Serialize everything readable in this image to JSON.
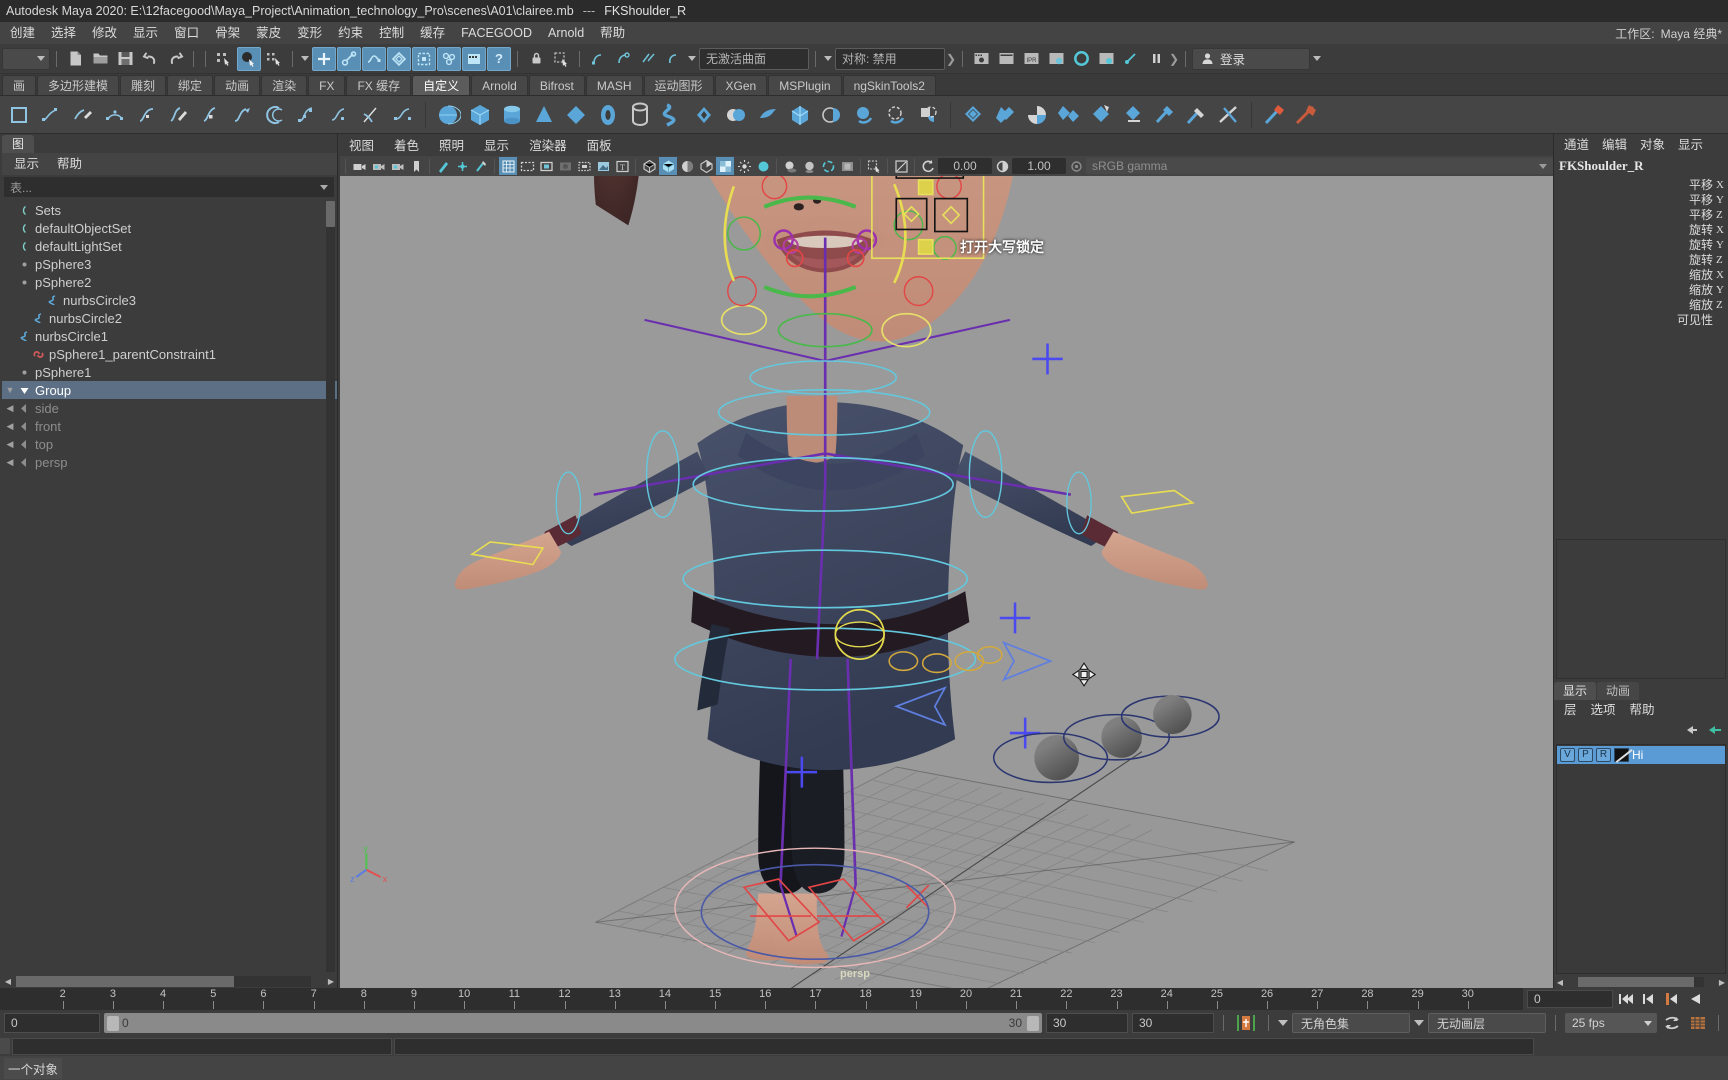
{
  "titlebar": {
    "app_title": "Autodesk Maya 2020: E:\\12facegood\\Maya_Project\\Animation_technology_Pro\\scenes\\A01\\clairee.mb",
    "separator": "---",
    "selected_node": "FKShoulder_R"
  },
  "menubar": {
    "items": [
      "创建",
      "选择",
      "修改",
      "显示",
      "窗口",
      "骨架",
      "蒙皮",
      "变形",
      "约束",
      "控制",
      "缓存",
      "FACEGOOD",
      "Arnold",
      "帮助"
    ],
    "workspace_label": "工作区:",
    "workspace_value": "Maya 经典*"
  },
  "statusline": {
    "mode_value": "",
    "live_surface_field": "无激活曲面",
    "symmetry_field": "对称: 禁用",
    "signin_label": "登录"
  },
  "shelf": {
    "tabs": [
      "画",
      "多边形建模",
      "雕刻",
      "绑定",
      "动画",
      "渲染",
      "FX",
      "FX 缓存",
      "自定义",
      "Arnold",
      "Bifrost",
      "MASH",
      "运动图形",
      "XGen",
      "MSPlugin",
      "ngSkinTools2"
    ],
    "active_tab": "自定义"
  },
  "outliner": {
    "tab_label": "图",
    "menu": [
      "显示",
      "帮助"
    ],
    "search_placeholder": "表...",
    "items": [
      {
        "label": "persp",
        "type": "camera",
        "depth": 0,
        "selected": false,
        "expand": "collapsed"
      },
      {
        "label": "top",
        "type": "camera",
        "depth": 0,
        "selected": false,
        "expand": "collapsed"
      },
      {
        "label": "front",
        "type": "camera",
        "depth": 0,
        "selected": false,
        "expand": "collapsed"
      },
      {
        "label": "side",
        "type": "camera",
        "depth": 0,
        "selected": false,
        "expand": "collapsed"
      },
      {
        "label": "Group",
        "type": "group",
        "depth": 0,
        "selected": true,
        "expand": "expanded"
      },
      {
        "label": "pSphere1",
        "type": "mesh",
        "depth": 0,
        "selected": false,
        "expand": "leaf"
      },
      {
        "label": "pSphere1_parentConstraint1",
        "type": "constraint",
        "depth": 1,
        "selected": false,
        "expand": "leaf"
      },
      {
        "label": "nurbsCircle1",
        "type": "curve",
        "depth": 0,
        "selected": false,
        "expand": "leaf"
      },
      {
        "label": "nurbsCircle2",
        "type": "curve",
        "depth": 1,
        "selected": false,
        "expand": "leaf"
      },
      {
        "label": "nurbsCircle3",
        "type": "curve",
        "depth": 2,
        "selected": false,
        "expand": "leaf"
      },
      {
        "label": "pSphere2",
        "type": "mesh",
        "depth": 0,
        "selected": false,
        "expand": "leaf"
      },
      {
        "label": "pSphere3",
        "type": "mesh",
        "depth": 0,
        "selected": false,
        "expand": "leaf"
      },
      {
        "label": "defaultLightSet",
        "type": "set",
        "depth": 0,
        "selected": false,
        "expand": "leaf"
      },
      {
        "label": "defaultObjectSet",
        "type": "set",
        "depth": 0,
        "selected": false,
        "expand": "leaf"
      },
      {
        "label": "Sets",
        "type": "set",
        "depth": 0,
        "selected": false,
        "expand": "leaf"
      }
    ]
  },
  "viewport": {
    "menu": [
      "视图",
      "着色",
      "照明",
      "显示",
      "渲染器",
      "面板"
    ],
    "exposure_value": "0.00",
    "gamma_value": "1.00",
    "color_profile": "sRGB gamma",
    "overlay_text": "打开大写锁定",
    "camera_label": "persp"
  },
  "channelbox": {
    "menu": [
      "通道",
      "编辑",
      "对象",
      "显示"
    ],
    "node_name": "FKShoulder_R",
    "attributes": [
      {
        "name": "平移",
        "axis": "X"
      },
      {
        "name": "平移",
        "axis": "Y"
      },
      {
        "name": "平移",
        "axis": "Z"
      },
      {
        "name": "旋转",
        "axis": "X"
      },
      {
        "name": "旋转",
        "axis": "Y"
      },
      {
        "name": "旋转",
        "axis": "Z"
      },
      {
        "name": "缩放",
        "axis": "X"
      },
      {
        "name": "缩放",
        "axis": "Y"
      },
      {
        "name": "缩放",
        "axis": "Z"
      },
      {
        "name": "可见性",
        "axis": ""
      }
    ]
  },
  "layereditor": {
    "tabs": [
      "显示",
      "动画"
    ],
    "active_tab": "显示",
    "menu": [
      "层",
      "选项",
      "帮助"
    ],
    "layers": [
      {
        "v": "V",
        "p": "P",
        "r": "R",
        "name": "Hi"
      }
    ]
  },
  "timeline": {
    "frames": [
      "2",
      "3",
      "4",
      "5",
      "6",
      "7",
      "8",
      "9",
      "10",
      "11",
      "12",
      "13",
      "14",
      "15",
      "16",
      "17",
      "18",
      "19",
      "20",
      "21",
      "22",
      "23",
      "24",
      "25",
      "26",
      "27",
      "28",
      "29",
      "30"
    ],
    "current_frame": "0"
  },
  "range": {
    "start_field": "0",
    "range_start": "0",
    "range_end": "30",
    "anim_end": "30",
    "playback_end": "30",
    "character_set": "无角色集",
    "anim_layer": "无动画层",
    "fps": "25 fps"
  },
  "helpline": {
    "message": "一个对象"
  },
  "colors": {
    "accent_blue": "#5a8fb5",
    "selection_blue": "#5d6f85",
    "layer_blue": "#5b9bd5",
    "panel_bg": "#3c3c3c",
    "viewport_bg": "#9a9a9a",
    "icon_cyan": "#55c8d8"
  }
}
